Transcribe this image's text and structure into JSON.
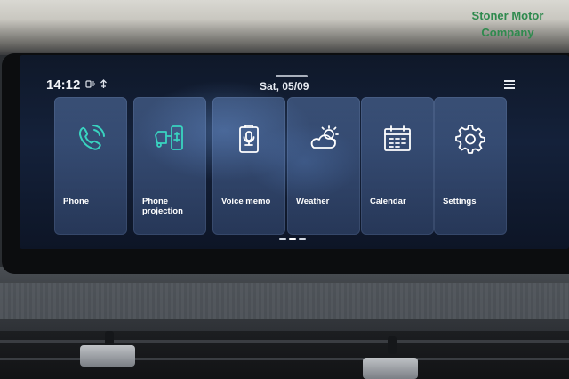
{
  "watermark": {
    "line1": "Stoner Motor",
    "line2": "Company"
  },
  "status_bar": {
    "time": "14:12",
    "icons": [
      "sync-icon",
      "connectivity-icon"
    ],
    "date": "Sat, 05/09",
    "menu_icon": "hamburger-menu-icon"
  },
  "tiles": [
    {
      "label": "Phone",
      "icon": "phone-icon",
      "icon_color": "#39d4c0"
    },
    {
      "label": "Phone projection",
      "icon": "phone-projection-icon",
      "icon_color": "#39d4c0"
    },
    {
      "label": "Voice memo",
      "icon": "microphone-icon",
      "icon_color": "#ffffff"
    },
    {
      "label": "Weather",
      "icon": "weather-icon",
      "icon_color": "#ffffff"
    },
    {
      "label": "Calendar",
      "icon": "calendar-icon",
      "icon_color": "#ffffff"
    },
    {
      "label": "Settings",
      "icon": "gear-icon",
      "icon_color": "#ffffff"
    }
  ],
  "pager": {
    "pages": 3,
    "current": 1
  },
  "colors": {
    "accent": "#39d4c0",
    "watermark": "#2f8a4e"
  }
}
